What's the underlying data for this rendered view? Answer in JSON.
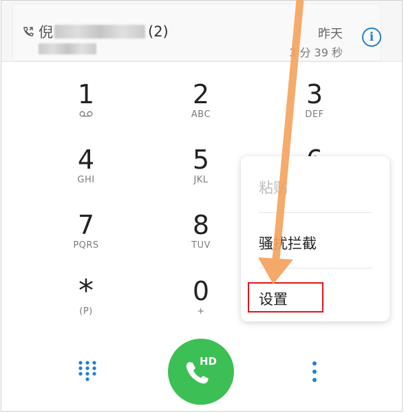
{
  "recent_call": {
    "name_first_char": "倪",
    "count": "(2)",
    "date": "昨天",
    "duration": "3 分 39 秒",
    "info_label": "i"
  },
  "keypad": {
    "keys": [
      {
        "digit": "1",
        "letters": ""
      },
      {
        "digit": "2",
        "letters": "ABC"
      },
      {
        "digit": "3",
        "letters": "DEF"
      },
      {
        "digit": "4",
        "letters": "GHI"
      },
      {
        "digit": "5",
        "letters": "JKL"
      },
      {
        "digit": "6",
        "letters": ""
      },
      {
        "digit": "7",
        "letters": "PQRS"
      },
      {
        "digit": "8",
        "letters": "TUV"
      },
      {
        "digit": "*",
        "letters": "(P)"
      },
      {
        "digit": "0",
        "letters": "+"
      }
    ]
  },
  "menu": {
    "items": [
      {
        "label": "粘贴",
        "disabled": true
      },
      {
        "label": "骚扰拦截",
        "disabled": false
      },
      {
        "label": "设置",
        "disabled": false
      }
    ]
  },
  "call_button": {
    "label": "HD",
    "color": "#3cbf55"
  },
  "colors": {
    "accent": "#1f7fd6",
    "annotation_red": "#e0141a",
    "annotation_orange": "#f4a460"
  },
  "icons": [
    "call-missed-icon",
    "info-icon",
    "voicemail-icon",
    "dialpad-icon",
    "phone-icon",
    "more-vertical-icon"
  ]
}
